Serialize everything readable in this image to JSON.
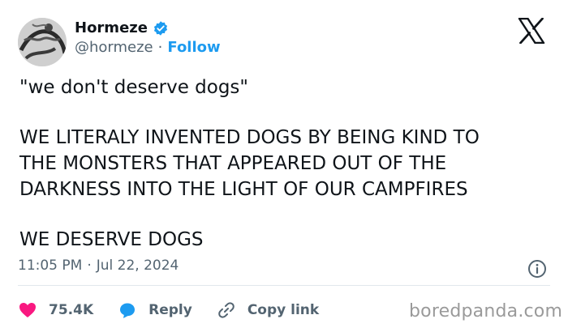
{
  "author": {
    "display_name": "Hormeze",
    "handle": "@hormeze",
    "separator": "·",
    "follow_label": "Follow",
    "verified": true
  },
  "tweet": {
    "line1": "\"we don't deserve dogs\"",
    "line2": "WE LITERALY INVENTED DOGS BY BEING KIND TO",
    "line3": "THE MONSTERS THAT APPEARED OUT OF THE",
    "line4": "DARKNESS INTO THE LIGHT OF OUR CAMPFIRES",
    "line5": "WE DESERVE DOGS"
  },
  "meta": {
    "time": "11:05 PM",
    "separator": "·",
    "date": "Jul 22, 2024"
  },
  "actions": {
    "likes": "75.4K",
    "reply_label": "Reply",
    "copy_link_label": "Copy link"
  },
  "watermark": "boredpanda.com",
  "colors": {
    "accent": "#1d9bf0",
    "like": "#f91880",
    "text": "#0f1419",
    "muted": "#536471"
  },
  "icons": [
    "avatar",
    "verified-badge-icon",
    "x-logo-icon",
    "info-icon",
    "heart-icon",
    "reply-bubble-icon",
    "link-icon"
  ]
}
